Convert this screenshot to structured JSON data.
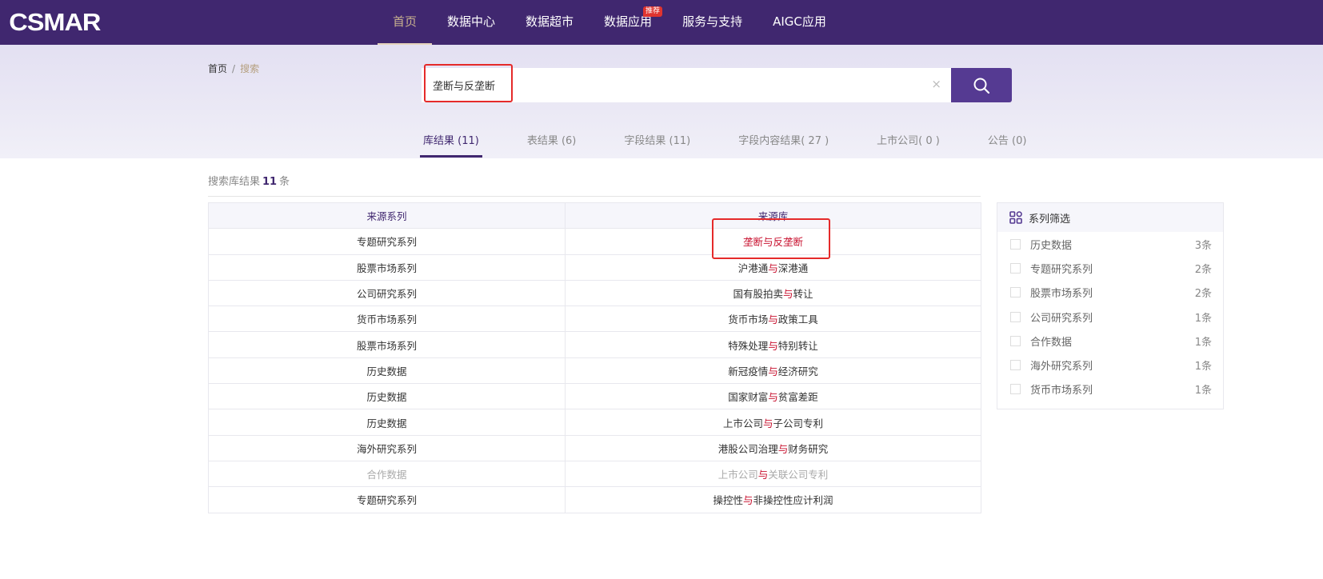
{
  "header": {
    "logo": "CSMAR",
    "nav": [
      {
        "label": "首页",
        "active": true
      },
      {
        "label": "数据中心"
      },
      {
        "label": "数据超市"
      },
      {
        "label": "数据应用",
        "badge": "推荐"
      },
      {
        "label": "服务与支持"
      },
      {
        "label": "AIGC应用"
      }
    ]
  },
  "breadcrumb": {
    "home": "首页",
    "sep": "/",
    "current": "搜索"
  },
  "search": {
    "value": "垄断与反垄断",
    "clear": "×"
  },
  "tabs": [
    "库结果 (11)",
    "表结果 (6)",
    "字段结果 (11)",
    "字段内容结果( 27 )",
    "上市公司( 0 )",
    "公告 (0)"
  ],
  "summary": {
    "prefix": "搜索库结果",
    "count": "11",
    "suffix": "条"
  },
  "table": {
    "headers": [
      "来源系列",
      "来源库"
    ],
    "rows": [
      {
        "series": "专题研究系列",
        "pre": "",
        "hl": "垄断与反垄断",
        "post": ""
      },
      {
        "series": "股票市场系列",
        "pre": "沪港通",
        "hl": "与",
        "post": "深港通"
      },
      {
        "series": "公司研究系列",
        "pre": "国有股拍卖",
        "hl": "与",
        "post": "转让"
      },
      {
        "series": "货币市场系列",
        "pre": "货币市场",
        "hl": "与",
        "post": "政策工具"
      },
      {
        "series": "股票市场系列",
        "pre": "特殊处理",
        "hl": "与",
        "post": "特别转让"
      },
      {
        "series": "历史数据",
        "pre": "新冠疫情",
        "hl": "与",
        "post": "经济研究"
      },
      {
        "series": "历史数据",
        "pre": "国家财富",
        "hl": "与",
        "post": "贫富差距"
      },
      {
        "series": "历史数据",
        "pre": "上市公司",
        "hl": "与",
        "post": "子公司专利"
      },
      {
        "series": "海外研究系列",
        "pre": "港股公司治理",
        "hl": "与",
        "post": "财务研究"
      },
      {
        "series": "合作数据",
        "pre": "上市公司",
        "hl": "与",
        "post": "关联公司专利",
        "dim": true
      },
      {
        "series": "专题研究系列",
        "pre": "操控性",
        "hl": "与",
        "post": "非操控性应计利润"
      }
    ]
  },
  "filter": {
    "title": "系列筛选",
    "items": [
      {
        "label": "历史数据",
        "count": "3条"
      },
      {
        "label": "专题研究系列",
        "count": "2条"
      },
      {
        "label": "股票市场系列",
        "count": "2条"
      },
      {
        "label": "公司研究系列",
        "count": "1条"
      },
      {
        "label": "合作数据",
        "count": "1条"
      },
      {
        "label": "海外研究系列",
        "count": "1条"
      },
      {
        "label": "货币市场系列",
        "count": "1条"
      }
    ]
  },
  "colors": {
    "brand": "#40276f",
    "highlight": "#c8102e",
    "accent": "#553a92"
  }
}
